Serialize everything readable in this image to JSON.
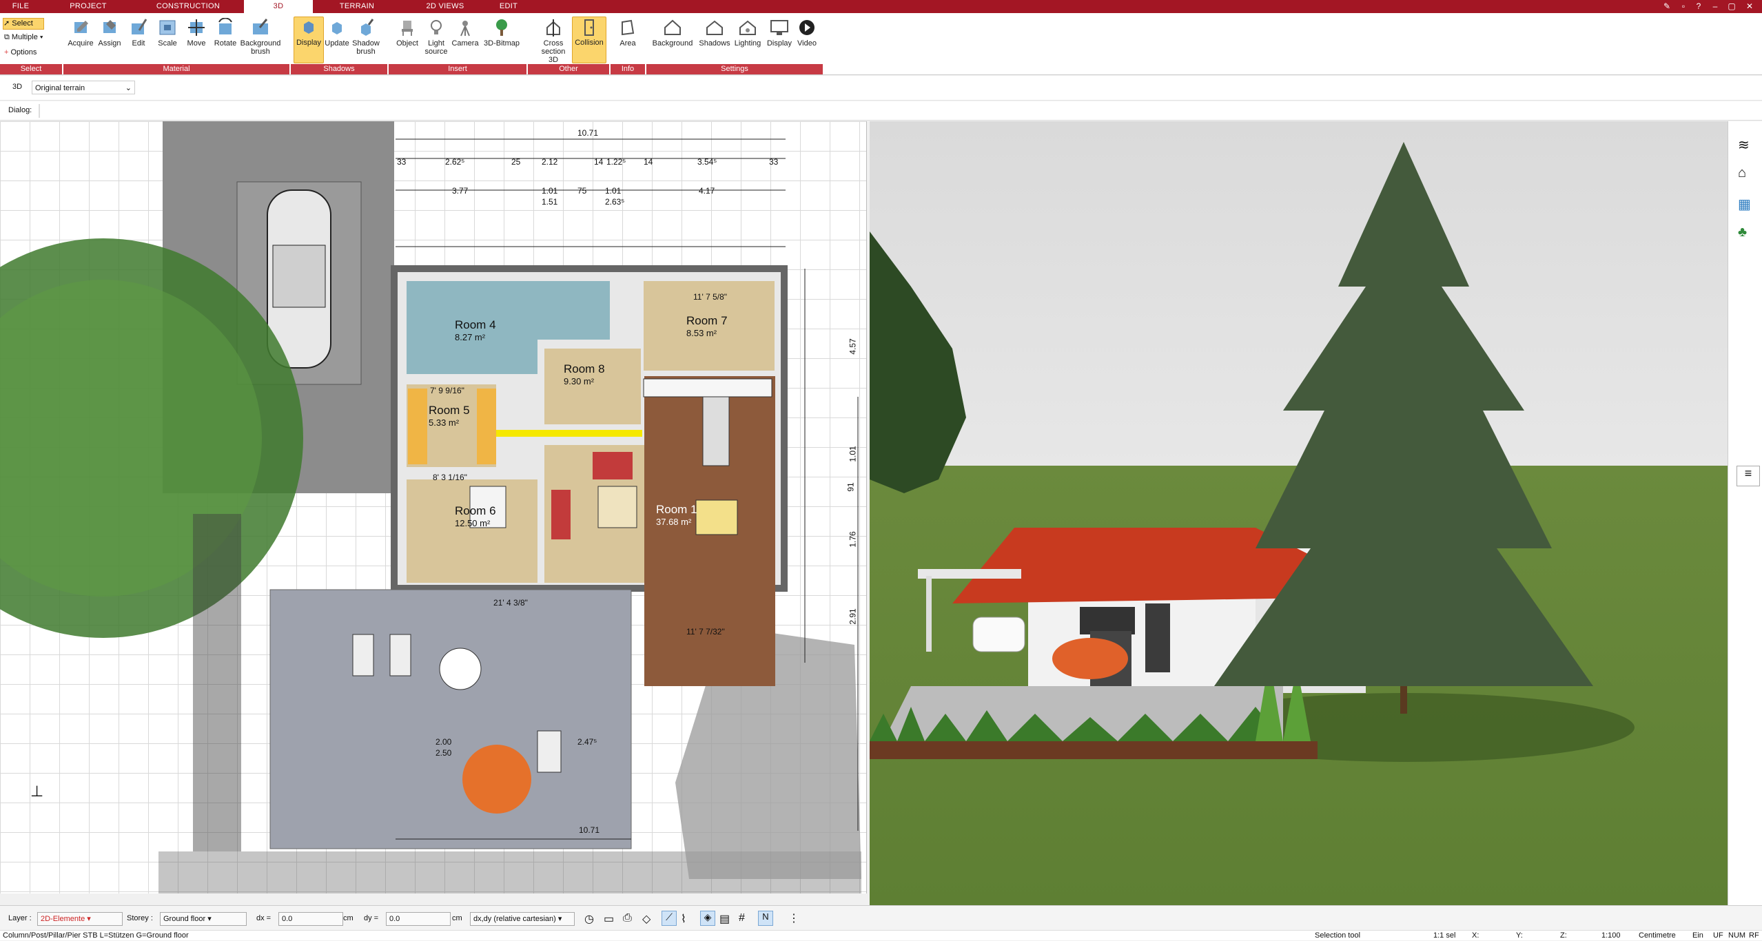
{
  "menu": {
    "tabs": [
      "FILE",
      "PROJECT",
      "CONSTRUCTION",
      "3D",
      "TERRAIN",
      "2D VIEWS",
      "EDIT"
    ],
    "active_tab": "3D"
  },
  "ribbon": {
    "select_group": {
      "select": "Select",
      "multiple": "Multiple",
      "options": "Options",
      "label": "Select"
    },
    "material": {
      "acquire": "Acquire",
      "assign": "Assign",
      "edit": "Edit",
      "scale": "Scale",
      "move": "Move",
      "rotate": "Rotate",
      "background_brush": "Background brush",
      "label": "Material"
    },
    "shadows": {
      "display": "Display",
      "update": "Update",
      "shadow_brush": "Shadow brush",
      "label": "Shadows"
    },
    "insert": {
      "object": "Object",
      "light_source": "Light source",
      "camera": "Camera",
      "bitmap": "3D-Bitmap",
      "label": "Insert"
    },
    "other": {
      "cross_section": "Cross section 3D",
      "collision": "Collision",
      "label": "Other"
    },
    "info": {
      "area": "Area",
      "label": "Info"
    },
    "settings": {
      "background": "Background",
      "shadows": "Shadows",
      "lighting": "Lighting",
      "display": "Display",
      "video": "Video",
      "label": "Settings"
    }
  },
  "toolbar2": {
    "mode": "3D",
    "terrain_select": "Original terrain"
  },
  "toolbar3": {
    "dialog_label": "Dialog:"
  },
  "plan": {
    "rooms": [
      {
        "name": "Room 4",
        "area": "8.27 m²"
      },
      {
        "name": "Room 7",
        "area": "8.53 m²"
      },
      {
        "name": "Room 8",
        "area": "9.30 m²"
      },
      {
        "name": "Room 5",
        "area": "5.33 m²"
      },
      {
        "name": "Room 6",
        "area": "12.50 m²"
      },
      {
        "name": "Room 1",
        "area": "37.68 m²"
      }
    ],
    "dims": {
      "top_total": "10.71",
      "d1": "2.62⁵",
      "d2": "25",
      "d3": "2.12",
      "d4": "14",
      "d5": "1.22⁵",
      "d6": "14",
      "d7": "3.54⁵",
      "d8": "33",
      "d9": "33",
      "r2a": "3.77",
      "r2b": "1.01",
      "r2c": "1.51",
      "r2d": "75",
      "r2e": "1.01",
      "r2f": "2.63⁵",
      "r2g": "4.17",
      "bottom_total": "10.71",
      "terrace1": "2.00",
      "terrace2": "2.50",
      "terrace3": "2.47⁵",
      "terrace4": "21' 4 3/8\"",
      "right1": "4.57",
      "right2": "1.01",
      "right3": "91",
      "right4": "1.76",
      "right5": "2.91",
      "room7_dim": "11' 7 5/8\"",
      "room1_dim": "11' 7 7/32\"",
      "room6_dim": "8' 3 1/16\"",
      "room5_dim": "7' 9 9/16\""
    }
  },
  "status": {
    "layer_label": "Layer :",
    "layer_value": "2D-Elemente",
    "storey_label": "Storey :",
    "storey_value": "Ground floor",
    "dx_label": "dx =",
    "dx_value": "0.0",
    "dx_unit": "cm",
    "dy_label": "dy =",
    "dy_value": "0.0",
    "dy_unit": "cm",
    "coord_mode": "dx,dy (relative cartesian)",
    "hint": "Column/Post/Pillar/Pier  STB L=Stützen G=Ground floor",
    "tool": "Selection tool",
    "sel_count": "1:1 sel",
    "x_label": "X:",
    "y_label": "Y:",
    "z_label": "Z:",
    "scale": "1:100",
    "unit": "Centimetre",
    "ein": "Ein",
    "uf": "UF",
    "num": "NUM",
    "rf": "RF"
  },
  "colors": {
    "accent": "#a31624",
    "active_btn": "#fbd56c",
    "room_bath": "#8fb7c1",
    "room_floor": "#d8c59a",
    "room_wood": "#8d5a3b",
    "highlight": "#f5e800"
  }
}
